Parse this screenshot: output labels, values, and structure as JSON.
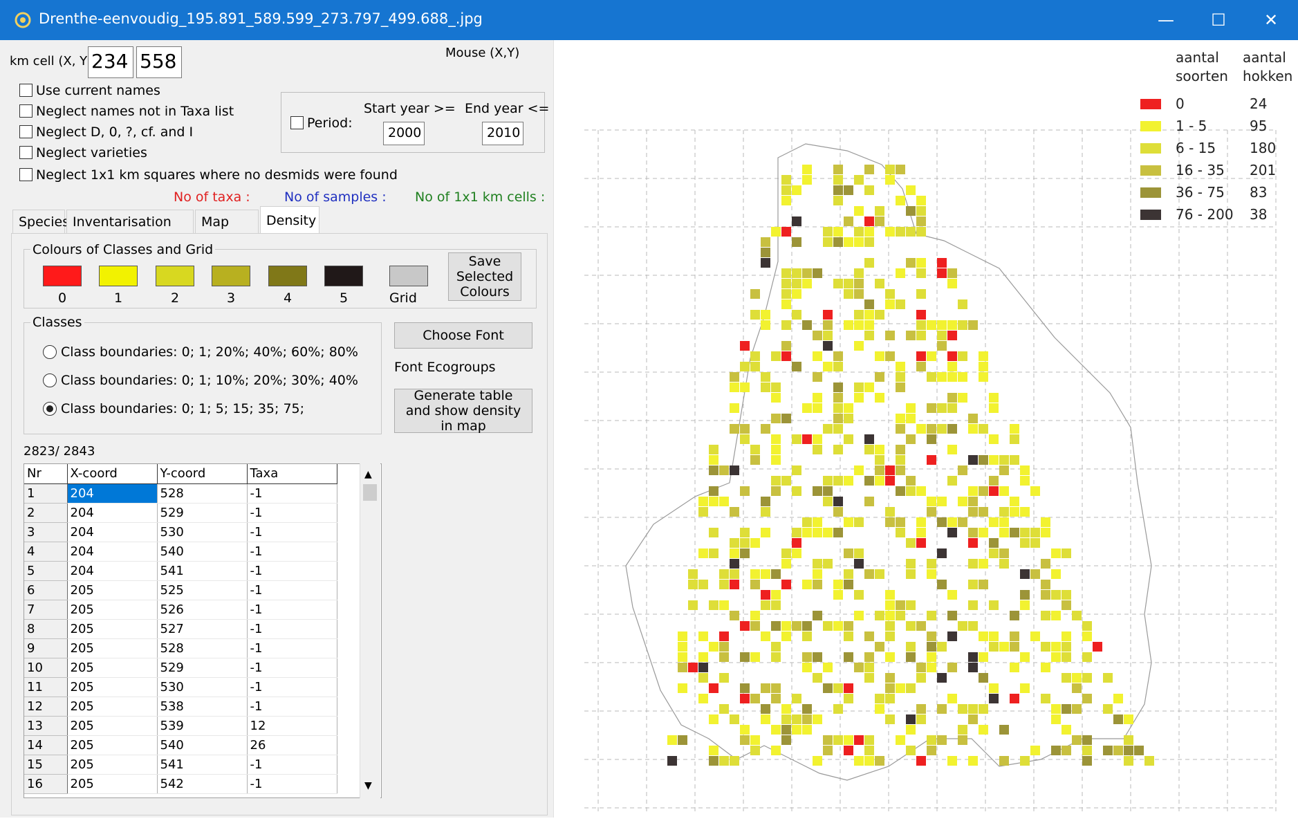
{
  "window": {
    "title": "Drenthe-eenvoudig_195.891_589.599_273.797_499.688_.jpg",
    "minimize": "—",
    "maximize": "☐",
    "close": "✕"
  },
  "top": {
    "km_cell_label": "km cell (X, Y)",
    "km_x": "234",
    "km_y": "558",
    "mouse_label": "Mouse (X,Y)"
  },
  "options": {
    "use_current_names": "Use current names",
    "neglect_names": "Neglect names not in Taxa list",
    "neglect_d": "Neglect D, 0, ?, cf. and I",
    "neglect_varieties": "Neglect varieties",
    "neglect_squares": "Neglect 1x1 km squares where no desmids were found"
  },
  "period": {
    "label": "Period:",
    "start_label": "Start year >=",
    "end_label": "End year <=",
    "start_value": "2000",
    "end_value": "2010"
  },
  "stats": {
    "taxa": "No of taxa :",
    "samples": "No of samples :",
    "cells": "No of 1x1 km cells :",
    "taxa_color": "#e02020",
    "samples_color": "#2030c0",
    "cells_color": "#208020"
  },
  "tabs": [
    "Species",
    "Inventarisation Info",
    "Map data",
    "Density"
  ],
  "colours": {
    "title": "Colours of Classes and Grid",
    "swatches": [
      {
        "label": "0",
        "color": "#ff1a1a"
      },
      {
        "label": "1",
        "color": "#f2f200"
      },
      {
        "label": "2",
        "color": "#d8d820"
      },
      {
        "label": "3",
        "color": "#b8b020"
      },
      {
        "label": "4",
        "color": "#807818"
      },
      {
        "label": "5",
        "color": "#201818"
      },
      {
        "label": "Grid",
        "color": "#c8c8c8"
      }
    ],
    "save_button": "Save Selected Colours"
  },
  "classes": {
    "title": "Classes",
    "options": [
      "Class boundaries:  0;  1;  20%;  40%;  60%;  80%",
      "Class boundaries:  0;  1;  10%;  20%;  30%;  40%",
      "Class boundaries:  0;  1;    5;   15;    35;   75;"
    ],
    "selected": 2
  },
  "buttons": {
    "choose_font": "Choose Font",
    "font_ecogroups": "Font Ecogroups",
    "generate": "Generate table and show density in map"
  },
  "table": {
    "count": "2823/ 2843",
    "headers": [
      "Nr",
      "X-coord",
      "Y-coord",
      "Taxa"
    ],
    "rows": [
      [
        "1",
        "204",
        "528",
        "-1"
      ],
      [
        "2",
        "204",
        "529",
        "-1"
      ],
      [
        "3",
        "204",
        "530",
        "-1"
      ],
      [
        "4",
        "204",
        "540",
        "-1"
      ],
      [
        "5",
        "204",
        "541",
        "-1"
      ],
      [
        "6",
        "205",
        "525",
        "-1"
      ],
      [
        "7",
        "205",
        "526",
        "-1"
      ],
      [
        "8",
        "205",
        "527",
        "-1"
      ],
      [
        "9",
        "205",
        "528",
        "-1"
      ],
      [
        "10",
        "205",
        "529",
        "-1"
      ],
      [
        "11",
        "205",
        "530",
        "-1"
      ],
      [
        "12",
        "205",
        "538",
        "-1"
      ],
      [
        "13",
        "205",
        "539",
        "12"
      ],
      [
        "14",
        "205",
        "540",
        "26"
      ],
      [
        "15",
        "205",
        "541",
        "-1"
      ],
      [
        "16",
        "205",
        "542",
        "-1"
      ]
    ]
  },
  "legend": {
    "header1a": "aantal",
    "header1b": "soorten",
    "header2a": "aantal",
    "header2b": "hokken",
    "rows": [
      {
        "range": "0",
        "count": "24",
        "color": "#ee2020"
      },
      {
        "range": "1 - 5",
        "count": "95",
        "color": "#f2f230"
      },
      {
        "range": "6 - 15",
        "count": "180",
        "color": "#dede38"
      },
      {
        "range": "16 - 35",
        "count": "201",
        "color": "#c8c040"
      },
      {
        "range": "36 - 75",
        "count": "83",
        "color": "#9c9438"
      },
      {
        "range": "76 - 200",
        "count": "38",
        "color": "#3c3434"
      }
    ]
  }
}
